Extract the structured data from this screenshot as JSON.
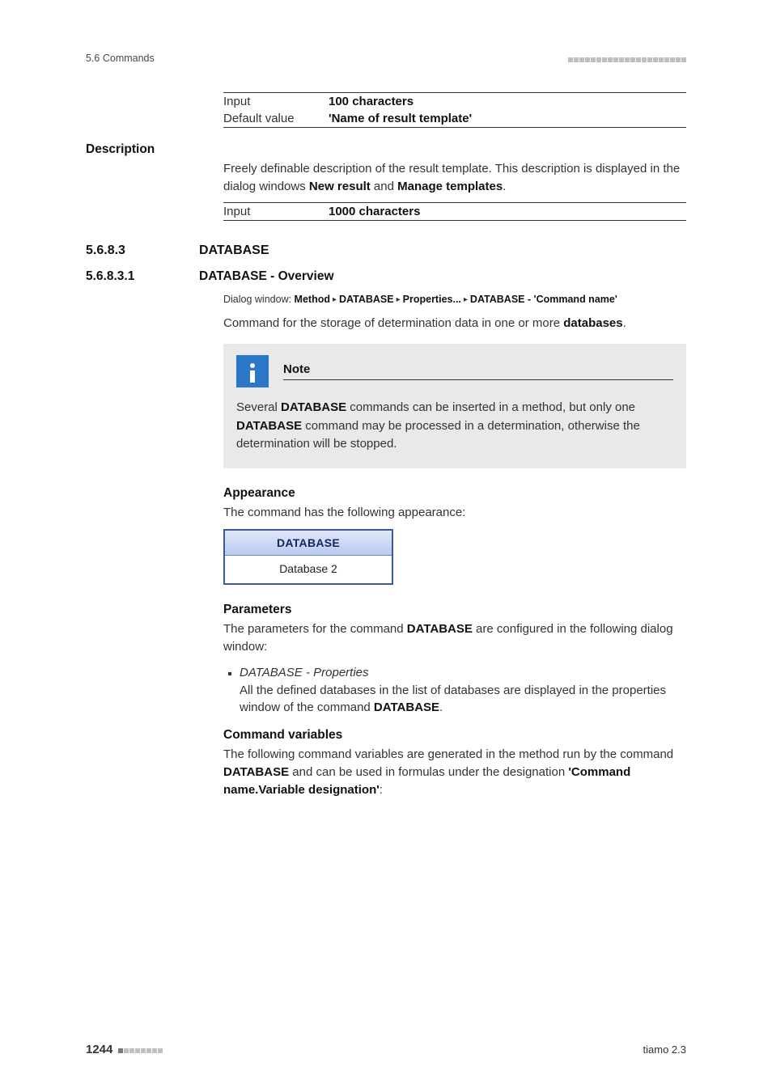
{
  "header": {
    "section_label": "5.6 Commands"
  },
  "defs": {
    "row1_label": "Input",
    "row1_value": "100 characters",
    "row2_label": "Default value",
    "row2_value": "'Name of result template'"
  },
  "description": {
    "heading": "Description",
    "para_before": "Freely definable description of the result template. This description is displayed in the dialog windows ",
    "bold1": "New result",
    "mid": " and ",
    "bold2": "Manage templates",
    "tail": ".",
    "row_label": "Input",
    "row_value": "1000 characters"
  },
  "sec_db": {
    "num": "5.6.8.3",
    "title": "DATABASE"
  },
  "sec_db_ov": {
    "num": "5.6.8.3.1",
    "title": "DATABASE - Overview"
  },
  "dialog_path": {
    "prefix": "Dialog window: ",
    "p1": "Method",
    "p2": "DATABASE",
    "p3": "Properties...",
    "p4": "DATABASE - 'Command name'"
  },
  "cmd_intro": {
    "pre": "Command for the storage of determination data in one or more ",
    "bold": "databases",
    "post": "."
  },
  "note": {
    "title": "Note",
    "t1": "Several ",
    "b1": "DATABASE",
    "t2": " commands can be inserted in a method, but only one ",
    "b2": "DATABASE",
    "t3": " command may be processed in a determination, otherwise the determination will be stopped."
  },
  "appearance": {
    "heading": "Appearance",
    "text": "The command has the following appearance:",
    "block_title": "DATABASE",
    "block_body": "Database 2"
  },
  "parameters": {
    "heading": "Parameters",
    "text_pre": "The parameters for the command ",
    "text_bold": "DATABASE",
    "text_post": " are configured in the following dialog window:",
    "item_title": "DATABASE - Properties",
    "item_body_pre": "All the defined databases in the list of databases are displayed in the properties window of the command ",
    "item_body_bold": "DATABASE",
    "item_body_post": "."
  },
  "cmdvars": {
    "heading": "Command variables",
    "t1": "The following command variables are generated in the method run by the command ",
    "b1": "DATABASE",
    "t2": " and can be used in formulas under the designation ",
    "b2": "'Command name.Variable designation'",
    "t3": ":"
  },
  "footer": {
    "page": "1244",
    "product": "tiamo 2.3"
  }
}
